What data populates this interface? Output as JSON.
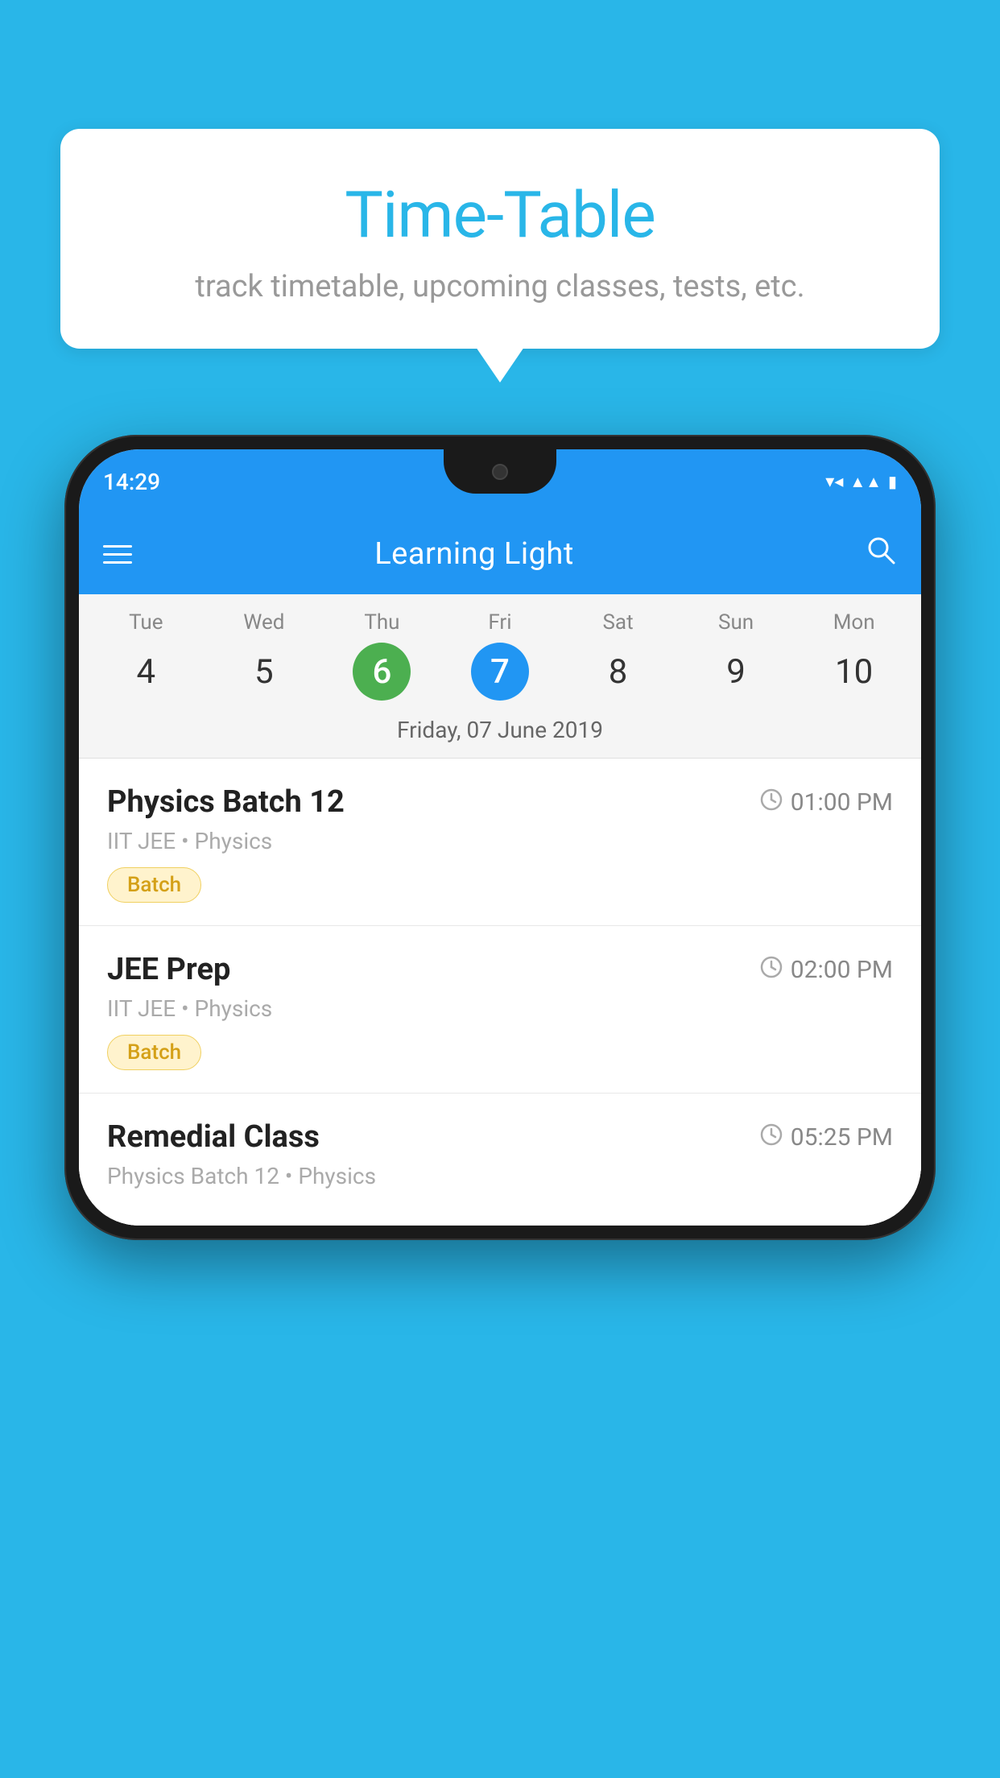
{
  "background_color": "#29B6E8",
  "bubble": {
    "title": "Time-Table",
    "subtitle": "track timetable, upcoming classes, tests, etc."
  },
  "phone": {
    "status_bar": {
      "time": "14:29",
      "icons": [
        "wifi",
        "signal",
        "battery"
      ]
    },
    "app_bar": {
      "title": "Learning Light"
    },
    "calendar": {
      "days": [
        {
          "name": "Tue",
          "num": "4",
          "state": "normal"
        },
        {
          "name": "Wed",
          "num": "5",
          "state": "normal"
        },
        {
          "name": "Thu",
          "num": "6",
          "state": "today"
        },
        {
          "name": "Fri",
          "num": "7",
          "state": "selected"
        },
        {
          "name": "Sat",
          "num": "8",
          "state": "normal"
        },
        {
          "name": "Sun",
          "num": "9",
          "state": "normal"
        },
        {
          "name": "Mon",
          "num": "10",
          "state": "normal"
        }
      ],
      "selected_date_label": "Friday, 07 June 2019"
    },
    "schedule_items": [
      {
        "title": "Physics Batch 12",
        "time": "01:00 PM",
        "subtitle": "IIT JEE • Physics",
        "badge": "Batch"
      },
      {
        "title": "JEE Prep",
        "time": "02:00 PM",
        "subtitle": "IIT JEE • Physics",
        "badge": "Batch"
      },
      {
        "title": "Remedial Class",
        "time": "05:25 PM",
        "subtitle": "Physics Batch 12 • Physics",
        "badge": null,
        "partial": true
      }
    ]
  }
}
